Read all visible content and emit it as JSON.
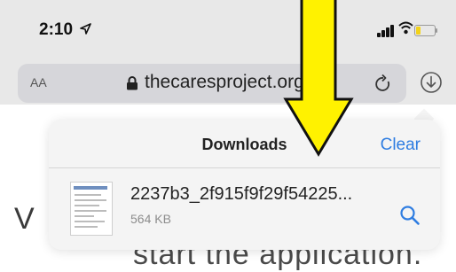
{
  "status_bar": {
    "time": "2:10",
    "icons": [
      "location-arrow-icon",
      "signal-icon",
      "wifi-icon",
      "battery-icon"
    ],
    "battery_color": "#f2d21a"
  },
  "address_bar": {
    "text_size_label": "AA",
    "url": "thecaresproject.org",
    "icons": [
      "lock-icon",
      "reload-icon",
      "download-icon"
    ]
  },
  "downloads": {
    "title": "Downloads",
    "clear_label": "Clear",
    "accent_color": "#2f7de1",
    "items": [
      {
        "filename": "2237b3_2f915f9f29f54225...",
        "size": "564 KB",
        "icons": [
          "document-thumbnail-icon",
          "magnifier-icon"
        ]
      }
    ]
  },
  "page": {
    "partial_left_text": "V",
    "partial_bottom_text": "start the application."
  },
  "annotation": {
    "arrow_color": "#fff200",
    "arrow_icon": "down-arrow-icon"
  }
}
